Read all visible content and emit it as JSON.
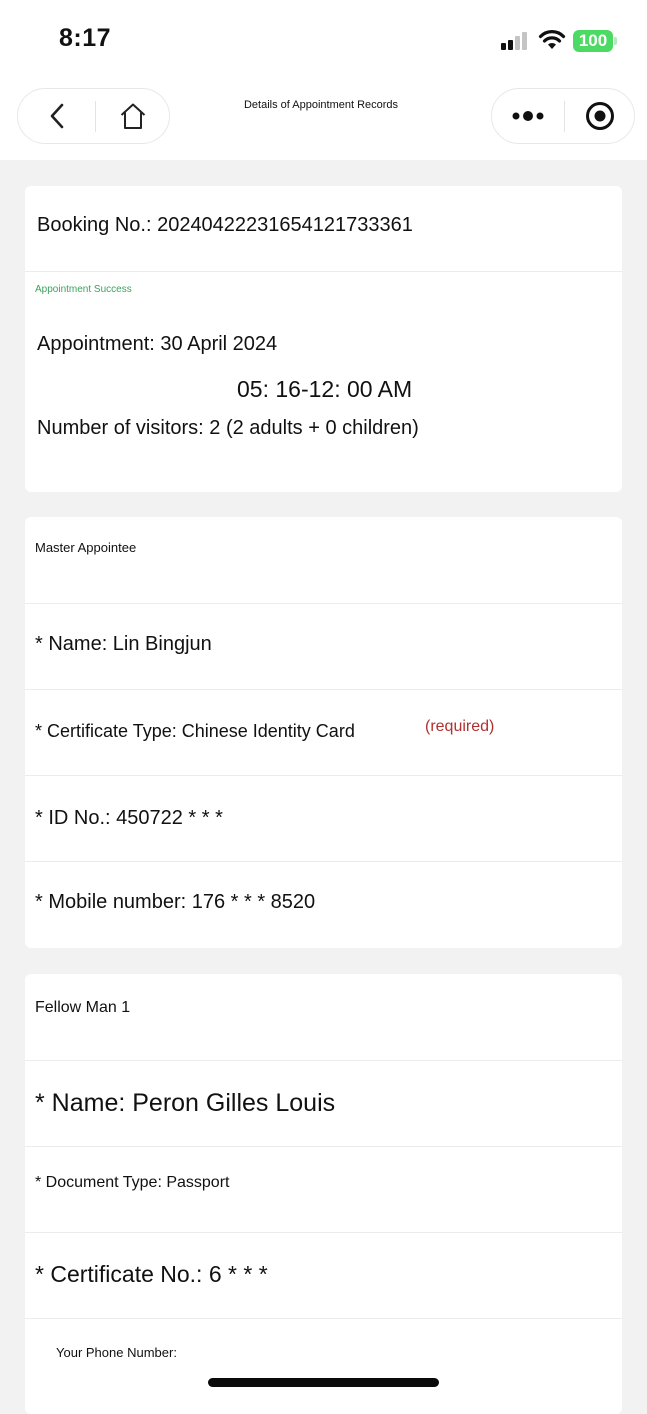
{
  "status_bar": {
    "time": "8:17",
    "battery": "100"
  },
  "nav": {
    "title": "Details of Appointment Records"
  },
  "booking": {
    "booking_no": "Booking No.: 20240422231654121733361",
    "status": "Appointment Success",
    "date": "Appointment: 30 April 2024",
    "time_slot": "05: 16-12: 00 AM",
    "visitors": "Number of visitors: 2 (2 adults + 0 children)"
  },
  "master": {
    "heading": "Master Appointee",
    "name": "* Name: Lin Bingjun",
    "certificate_type": "* Certificate Type: Chinese Identity Card",
    "required_note": "(required)",
    "id_no": "* ID No.: 450722 * * *",
    "mobile": "* Mobile number: 176 * * * 8520"
  },
  "fellow": {
    "heading": "Fellow Man 1",
    "name": "* Name: Peron Gilles Louis",
    "document_type": "* Document Type: Passport",
    "certificate_no": "* Certificate No.: 6 * * *",
    "phone_label": "Your Phone Number:"
  },
  "colors": {
    "status_green": "#3aa35c",
    "required_red": "#b03030",
    "battery_green": "#4cd964"
  }
}
